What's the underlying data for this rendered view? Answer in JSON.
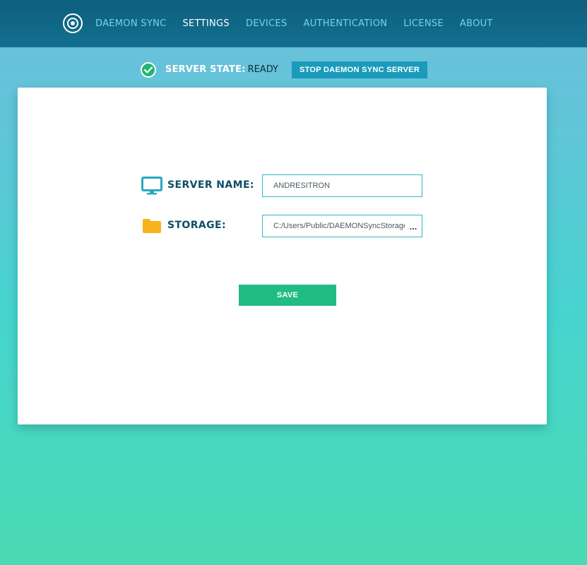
{
  "nav": {
    "logo_icon": "daemon-sync-logo-icon",
    "items": [
      {
        "label": "DAEMON SYNC",
        "active": false
      },
      {
        "label": "SETTINGS",
        "active": true
      },
      {
        "label": "DEVICES",
        "active": false
      },
      {
        "label": "AUTHENTICATION",
        "active": false
      },
      {
        "label": "LICENSE",
        "active": false
      },
      {
        "label": "ABOUT",
        "active": false
      }
    ]
  },
  "status": {
    "icon": "check-circle-icon",
    "label": "SERVER STATE:",
    "value": "READY",
    "stop_button": "STOP DAEMON SYNC SERVER"
  },
  "settings": {
    "server_name": {
      "icon": "monitor-icon",
      "label": "SERVER NAME:",
      "value": "ANDRESITRON"
    },
    "storage": {
      "icon": "folder-icon",
      "label": "STORAGE:",
      "value": "C:/Users/Public/DAEMONSyncStorage",
      "browse_label": "..."
    },
    "save_button": "SAVE"
  },
  "colors": {
    "accent": "#1a9bbb",
    "save": "#1fbc84",
    "nav_bg": "#0d5f7d",
    "folder": "#f7b21c",
    "monitor": "#29a9c1"
  }
}
